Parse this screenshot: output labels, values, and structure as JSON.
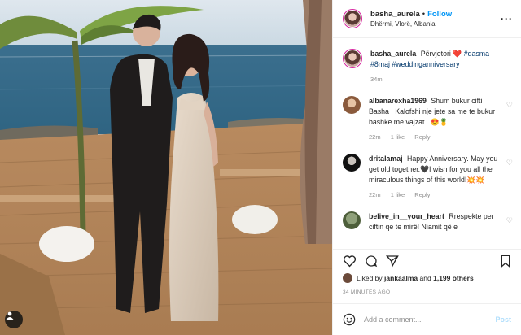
{
  "header": {
    "username": "basha_aurela",
    "separator": "•",
    "follow_label": "Follow",
    "location": "Dhërmi, Vlorë, Albania",
    "more_label": "···"
  },
  "caption": {
    "username": "basha_aurela",
    "text_before_heart": "Përvjetori",
    "heart_emoji": "❤️",
    "tags": "#dasma #8maj #weddinganniversary",
    "time": "34m"
  },
  "comments": [
    {
      "username": "albanarexha1969",
      "text": "Shum bukur cifti Basha . Kalofshi nje jete sa me te bukur bashke me vajzat . 😍🍍",
      "time": "22m",
      "likes": "1 like",
      "reply": "Reply"
    },
    {
      "username": "dritalamaj",
      "text": "Happy Anniversary. May you get old together.🖤I wish for you all the miraculous things of this world!💥💥",
      "time": "22m",
      "likes": "1 like",
      "reply": "Reply"
    },
    {
      "username": "belive_in__your_heart",
      "text": "Rrespekte per ciftin qe te mirë! Niamit që e",
      "time": "",
      "likes": "",
      "reply": ""
    }
  ],
  "likes": {
    "prefix": "Liked by",
    "user": "jankaalma",
    "middle": "and",
    "count": "1,199 others"
  },
  "timestamp": "34 MINUTES AGO",
  "add_comment": {
    "placeholder": "Add a comment...",
    "post_label": "Post"
  },
  "colors": {
    "follow_blue": "#0095f6",
    "like_red": "#ed4956",
    "muted": "#8e8e8e"
  }
}
